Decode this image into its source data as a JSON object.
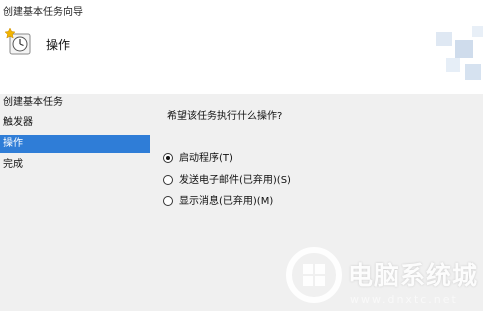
{
  "window": {
    "title": "创建基本任务向导"
  },
  "header": {
    "title": "操作",
    "icon": "task-scheduler-clock-icon"
  },
  "sidebar": {
    "items": [
      {
        "label": "创建基本任务",
        "active": false
      },
      {
        "label": "触发器",
        "active": false
      },
      {
        "label": "操作",
        "active": true
      },
      {
        "label": "完成",
        "active": false
      }
    ]
  },
  "main": {
    "question": "希望该任务执行什么操作?",
    "options": [
      {
        "label": "启动程序(T)",
        "checked": true
      },
      {
        "label": "发送电子邮件(已弃用)(S)",
        "checked": false
      },
      {
        "label": "显示消息(已弃用)(M)",
        "checked": false
      }
    ]
  },
  "watermark": {
    "text": "电脑系统城",
    "url": "www.dnxtc.net",
    "icon": "watermark-logo-icon"
  },
  "colors": {
    "accent": "#2f7dd7",
    "content_bg": "#f0f0f0",
    "header_bg": "#ffffff"
  }
}
